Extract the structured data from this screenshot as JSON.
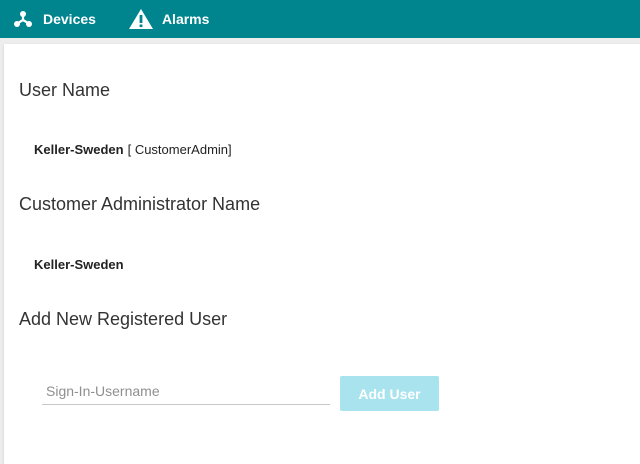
{
  "nav": {
    "items": [
      {
        "label": "Devices",
        "icon": "devices-icon"
      },
      {
        "label": "Alarms",
        "icon": "alarm-warning-icon"
      }
    ],
    "background": "#00858f"
  },
  "user_section": {
    "title": "User Name",
    "name": "Keller-Sweden",
    "role": "[ CustomerAdmin]"
  },
  "admin_section": {
    "title": "Customer Administrator Name",
    "name": "Keller-Sweden"
  },
  "add_user_section": {
    "title": "Add New Registered User",
    "input_placeholder": "Sign-In-Username",
    "input_value": "",
    "button_label": "Add User",
    "button_color": "#a9e4ee"
  }
}
